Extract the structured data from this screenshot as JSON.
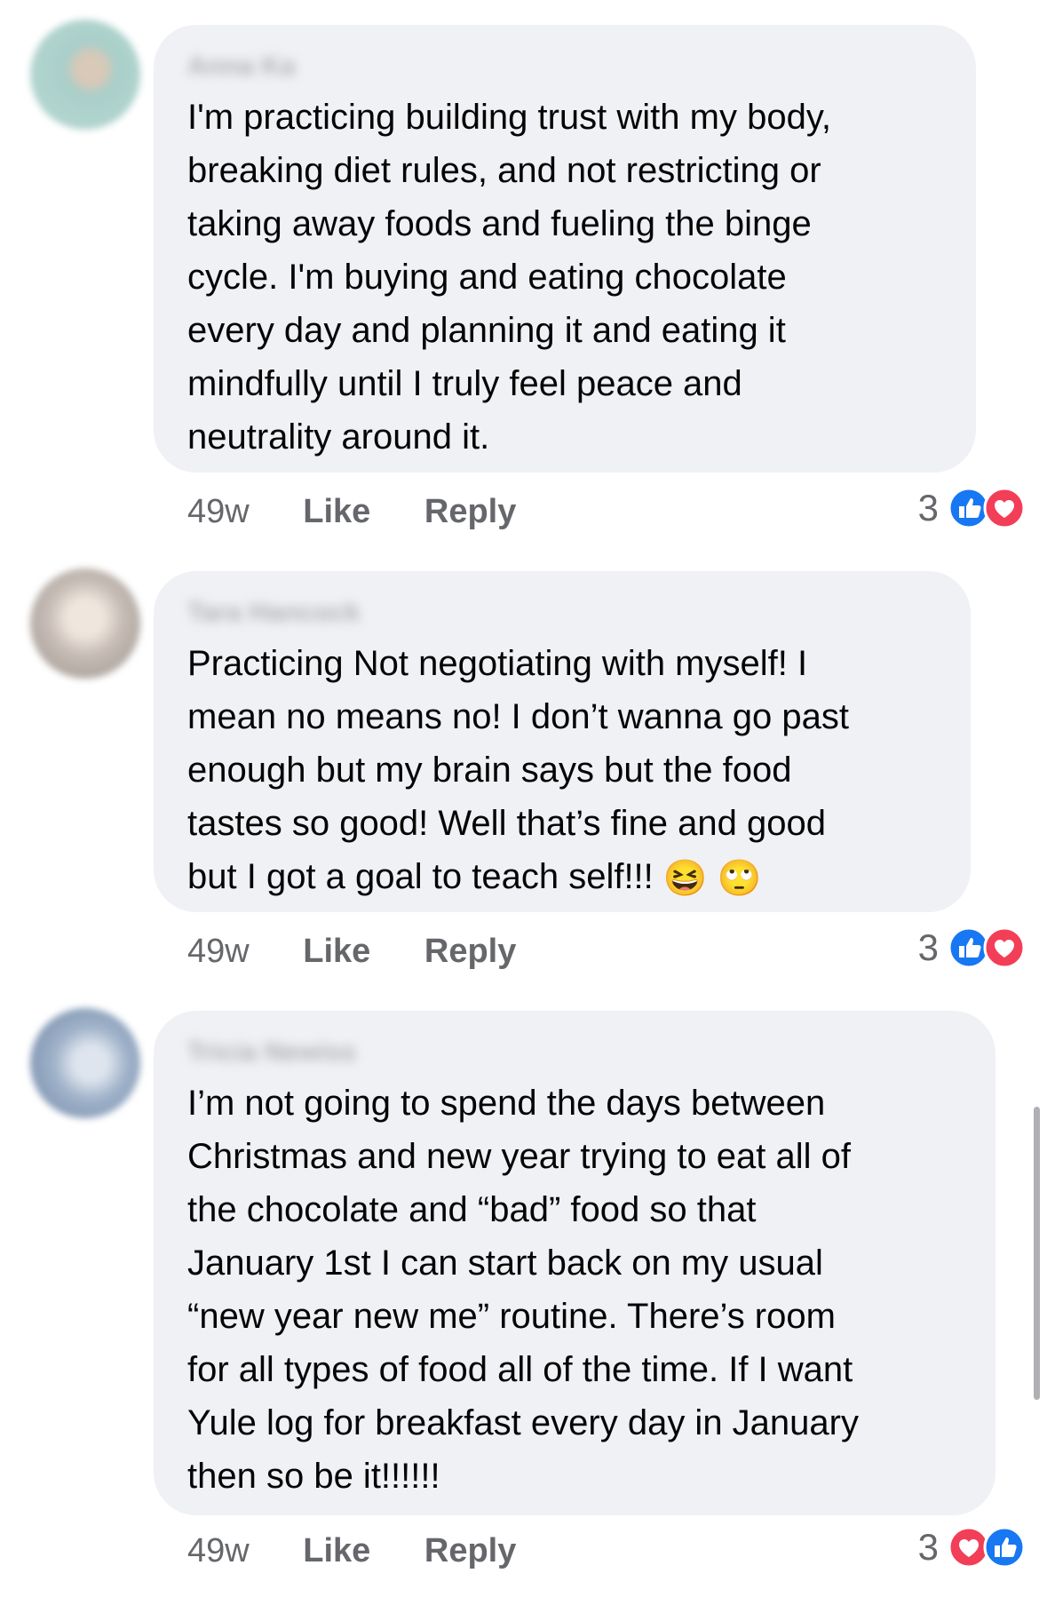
{
  "comments": [
    {
      "author": "Anna Ka",
      "avatar_color": "#a9cfc9",
      "text": "I'm practicing building trust with my body,\nbreaking diet rules, and not restricting or\ntaking away foods and fueling the binge\ncycle. I'm buying and eating chocolate\nevery day and planning it and eating it\nmindfully until I truly feel peace and\nneutrality around it.",
      "time": "49w",
      "like_label": "Like",
      "reply_label": "Reply",
      "reaction_count": "3",
      "reactions": [
        "like-icon",
        "love-icon"
      ]
    },
    {
      "author": "Tara Hancock",
      "avatar_color": "#c7bdb6",
      "text": "Practicing Not negotiating with myself! I\nmean no means no! I don’t wanna go past\nenough but my brain says but the food\ntastes so good! Well that’s fine and good\nbut I got a goal to teach  self!!!",
      "emojis": [
        "😆",
        "🙄"
      ],
      "time": "49w",
      "like_label": "Like",
      "reply_label": "Reply",
      "reaction_count": "3",
      "reactions": [
        "like-icon",
        "love-icon"
      ]
    },
    {
      "author": "Tricia Newiss",
      "avatar_color": "#9fb2c9",
      "text": "I’m not going to spend the days between\nChristmas and new year trying to eat all of\nthe chocolate and “bad” food so that\nJanuary 1st I can start back on my usual\n“new year new me” routine. There’s room\nfor all types of food all of the time. If I want\nYule log for breakfast every day in January\nthen so be it!!!!!!",
      "time": "49w",
      "like_label": "Like",
      "reply_label": "Reply",
      "reaction_count": "3",
      "reactions": [
        "love-icon",
        "like-icon"
      ]
    }
  ],
  "colors": {
    "bubble": "#f0f1f5",
    "meta_text": "#65676b",
    "like_blue": "#1877f2",
    "love_red": "#f33e58"
  }
}
